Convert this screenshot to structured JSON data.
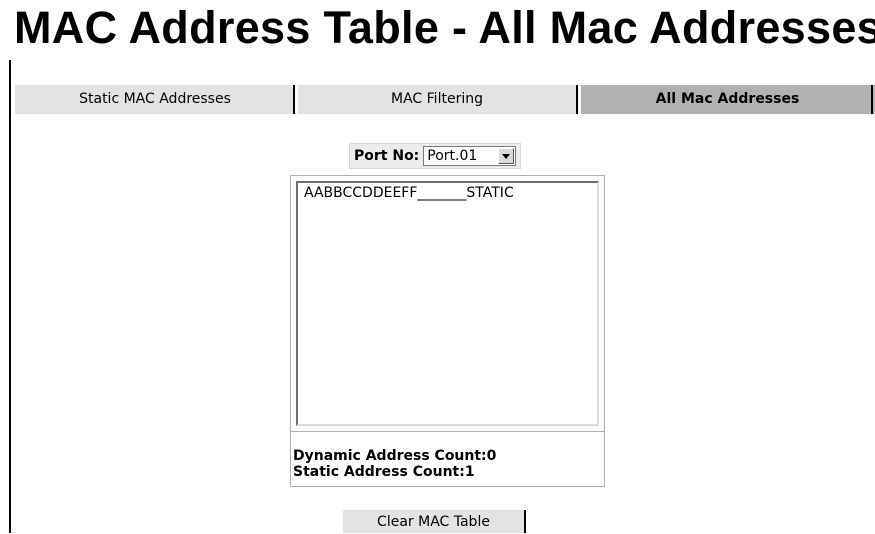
{
  "page": {
    "title": "MAC Address Table - All Mac Addresses"
  },
  "tabs": [
    {
      "label": "Static MAC Addresses",
      "active": false
    },
    {
      "label": "MAC Filtering",
      "active": false
    },
    {
      "label": "All Mac Addresses",
      "active": true
    }
  ],
  "port_selector": {
    "label": "Port No:",
    "selected": "Port.01"
  },
  "mac_list": {
    "items": [
      "AABBCCDDEEFF_______STATIC"
    ]
  },
  "counts": {
    "dynamic": "Dynamic Address Count:0",
    "static": "Static Address Count:1"
  },
  "actions": {
    "clear_label": "Clear MAC Table"
  },
  "colors": {
    "tab_inactive": "#e3e3e3",
    "tab_active": "#b2b2b2"
  }
}
